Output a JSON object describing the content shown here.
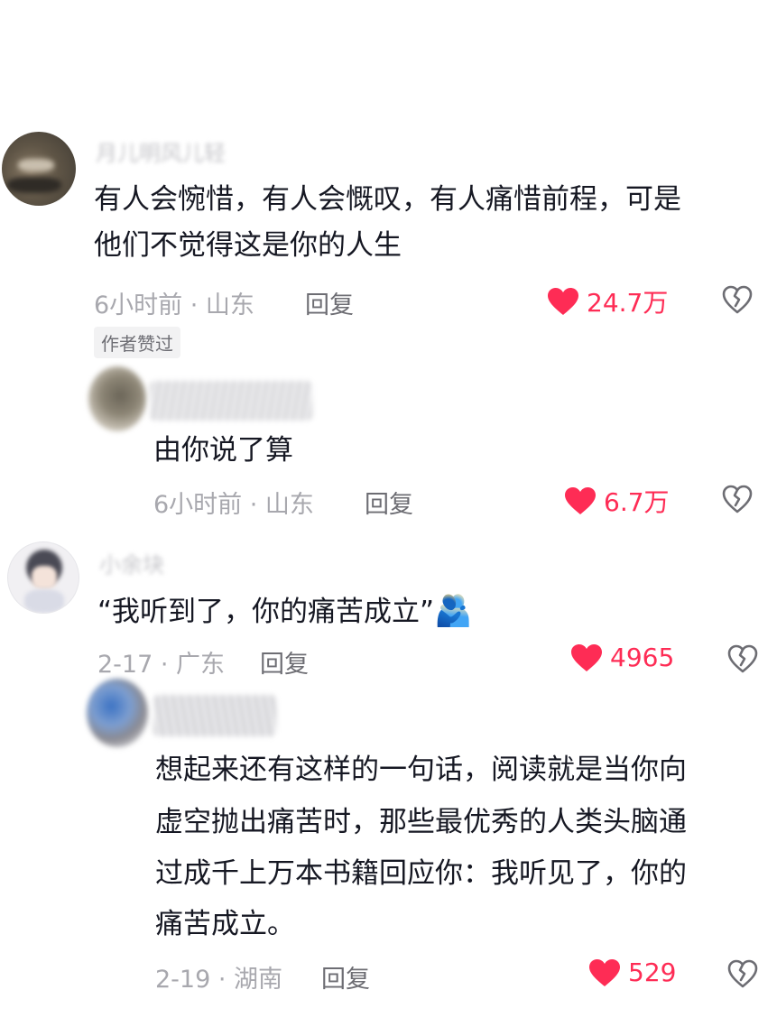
{
  "comments": [
    {
      "username": "月儿明风儿轻",
      "text_lines": [
        "有人会惋惜，有人会慨叹，有人痛惜前程，可是",
        "他们不觉得这是你的人生"
      ],
      "meta": "6小时前 · 山东",
      "reply_label": "回复",
      "likes": "24.7万",
      "badge": "作者赞过",
      "reply": {
        "text_lines": [
          "由你说了算"
        ],
        "meta": "6小时前 · 山东",
        "reply_label": "回复",
        "likes": "6.7万"
      }
    },
    {
      "username": "小余块",
      "text_lines": [
        "“我听到了，你的痛苦成立”"
      ],
      "emoji": "🫂",
      "meta": "2-17 · 广东",
      "reply_label": "回复",
      "likes": "4965",
      "reply": {
        "text_lines": [
          "想起来还有这样的一句话，阅读就是当你向",
          "虚空抛出痛苦时，那些最优秀的人类头脑通",
          "过成千上万本书籍回应你：我听见了，你的",
          "痛苦成立。"
        ],
        "meta": "2-19 · 湖南",
        "reply_label": "回复",
        "likes": "529"
      }
    }
  ],
  "colors": {
    "like": "#fe2c55",
    "meta": "#a8a8ae",
    "text": "#161823"
  },
  "icons": {
    "like": "heart-icon",
    "dislike": "broken-heart-icon"
  }
}
